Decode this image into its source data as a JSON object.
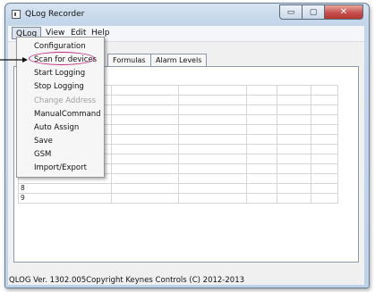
{
  "window": {
    "title": "QLog Recorder",
    "controls": {
      "minimize": "▭",
      "maximize": "▢",
      "close": "✕"
    }
  },
  "menubar": [
    "QLog",
    "View",
    "Edit",
    "Help"
  ],
  "qlog_menu": {
    "items": [
      {
        "label": "Configuration",
        "enabled": true
      },
      {
        "label": "Scan for devices",
        "enabled": true,
        "highlighted": true
      },
      {
        "label": "Start Logging",
        "enabled": true
      },
      {
        "label": "Stop Logging",
        "enabled": true
      },
      {
        "label": "Change Address",
        "enabled": false
      },
      {
        "label": "ManualCommand",
        "enabled": true
      },
      {
        "label": "Auto Assign",
        "enabled": true
      },
      {
        "label": "Save",
        "enabled": true
      },
      {
        "label": "GSM",
        "enabled": true
      },
      {
        "label": "Import/Export",
        "enabled": true
      }
    ]
  },
  "tabs": [
    "Formulas",
    "Alarm Levels"
  ],
  "grid": {
    "row_numbers": [
      "8",
      "9"
    ]
  },
  "status": {
    "text": "QLOG Ver. 1302.005Copyright Keynes Controls (C) 2012-2013"
  },
  "annotation_color": "#c22b82"
}
